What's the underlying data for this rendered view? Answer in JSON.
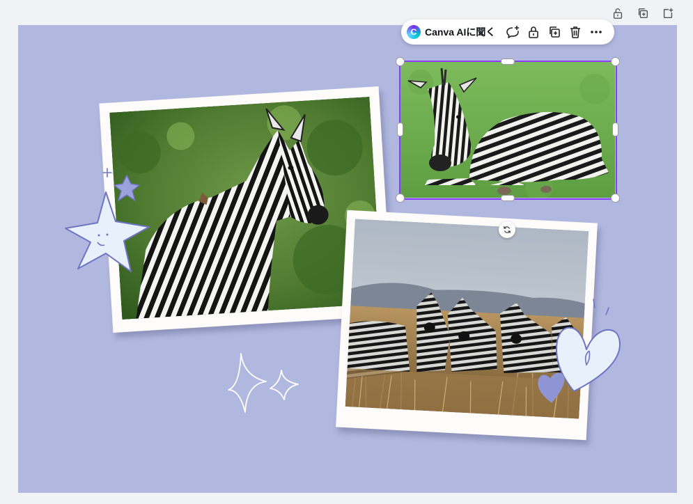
{
  "toolbar": {
    "ai_button_label": "Canva AIに聞く",
    "ai_logo_letter": "C",
    "icons": [
      "comment-add-icon",
      "lock-icon",
      "duplicate-icon",
      "trash-icon",
      "more-icon"
    ]
  },
  "page_actions": {
    "icons": [
      "lock-icon",
      "duplicate-page-icon",
      "add-page-icon"
    ]
  },
  "canvas": {
    "background": "#b0b8e0"
  },
  "colors": {
    "selection": "#8b3dff",
    "sticker_fill": "#e7f0fb",
    "sticker_stroke": "#6e74c2"
  }
}
